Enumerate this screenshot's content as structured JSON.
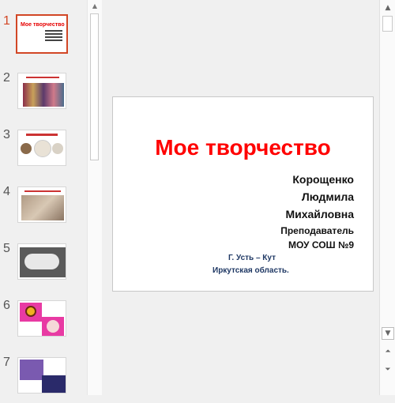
{
  "thumbnails": [
    {
      "num": "1",
      "mini_title": "Мое творчество"
    },
    {
      "num": "2"
    },
    {
      "num": "3"
    },
    {
      "num": "4"
    },
    {
      "num": "5"
    },
    {
      "num": "6"
    },
    {
      "num": "7"
    }
  ],
  "slide": {
    "title": "Мое творчество",
    "author_lines": [
      "Корощенко",
      "Людмила",
      "Михайловна",
      "Преподаватель",
      "МОУ СОШ №9"
    ],
    "location_lines": [
      "Г. Усть – Кут",
      "Иркутская область."
    ]
  },
  "colors": {
    "accent": "#d24726",
    "title": "#ff0000",
    "location": "#1f3864"
  }
}
